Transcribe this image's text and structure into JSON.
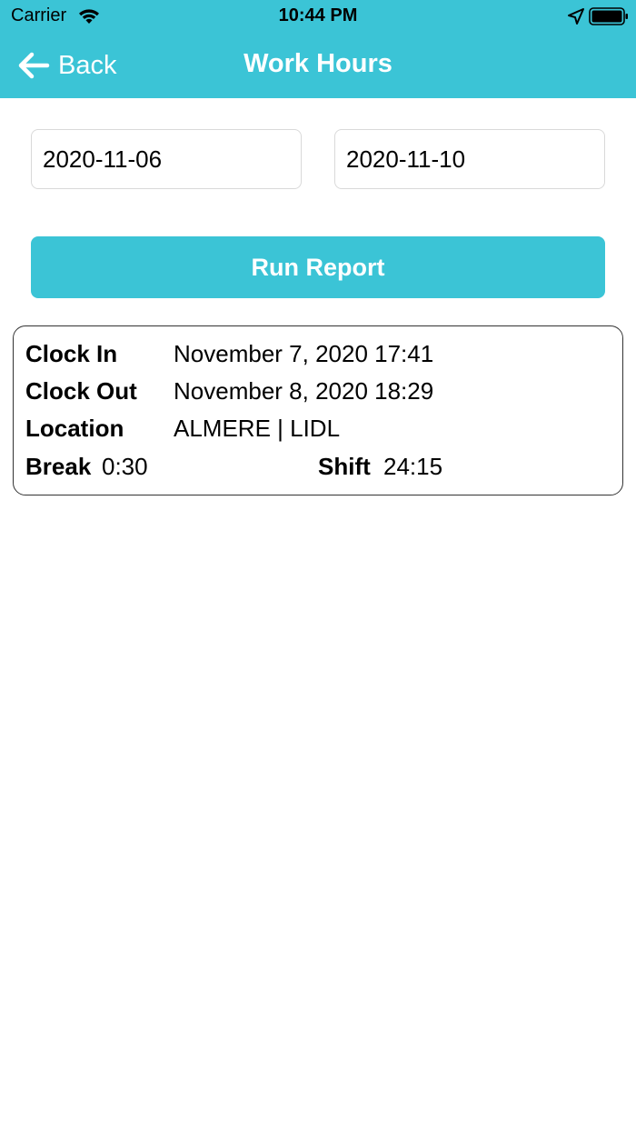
{
  "status_bar": {
    "carrier": "Carrier",
    "time": "10:44 PM"
  },
  "nav": {
    "back_label": "Back",
    "title": "Work Hours",
    "accent_color": "#3bc4d6"
  },
  "filters": {
    "start_date": "2020-11-06",
    "end_date": "2020-11-10",
    "run_label": "Run Report"
  },
  "report": {
    "clock_in_label": "Clock In",
    "clock_in_value": "November 7, 2020 17:41",
    "clock_out_label": "Clock Out",
    "clock_out_value": "November 8, 2020 18:29",
    "location_label": "Location",
    "location_value": "ALMERE | LIDL",
    "break_label": "Break",
    "break_value": "0:30",
    "shift_label": "Shift",
    "shift_value": "24:15"
  },
  "icons": [
    "wifi-icon",
    "location-arrow-icon",
    "battery-icon",
    "back-arrow-icon"
  ]
}
